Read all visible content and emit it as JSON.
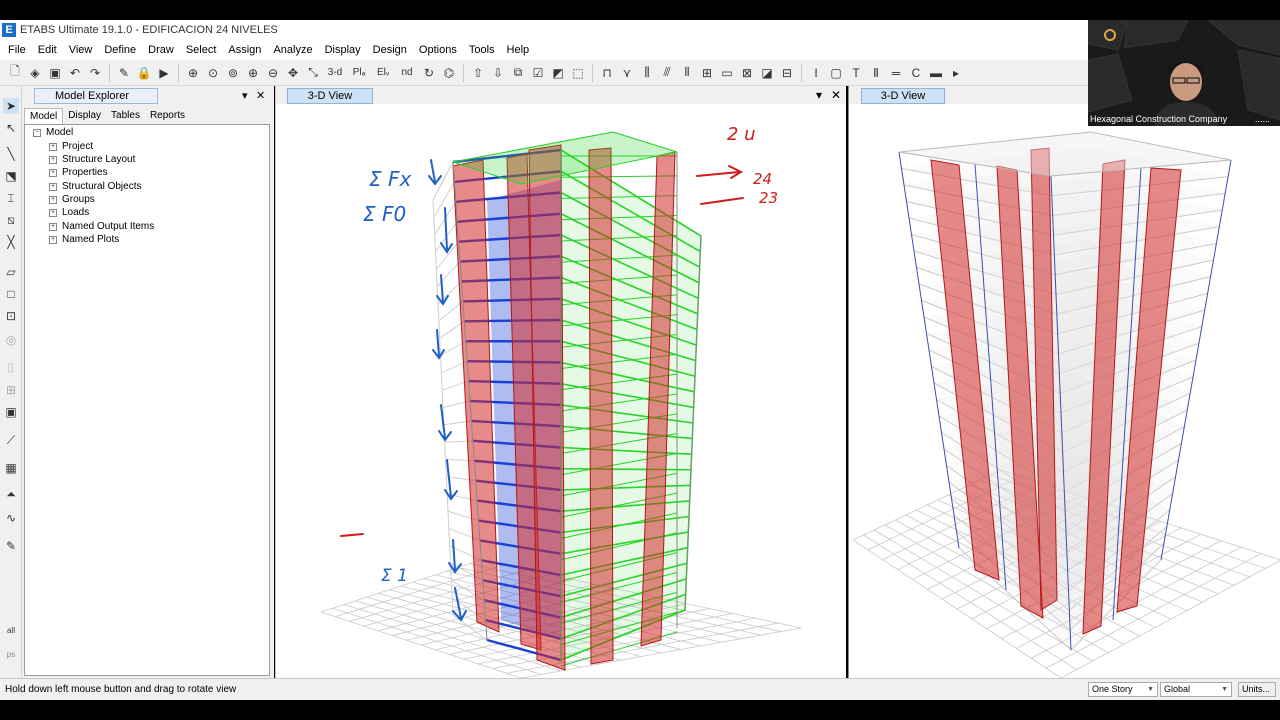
{
  "app": {
    "logo_letter": "E",
    "title": "ETABS Ultimate 19.1.0 - EDIFICACION 24 NIVELES"
  },
  "menu": [
    "File",
    "Edit",
    "View",
    "Define",
    "Draw",
    "Select",
    "Assign",
    "Analyze",
    "Display",
    "Design",
    "Options",
    "Tools",
    "Help"
  ],
  "toolbar": {
    "view_3d": "3-d",
    "view_plan": "Plₐ",
    "view_elev": "Elᵥ",
    "view_nd": "nd"
  },
  "explorer": {
    "title": "Model Explorer",
    "tabs": [
      "Model",
      "Display",
      "Tables",
      "Reports"
    ],
    "active_tab": "Model",
    "root": "Model",
    "items": [
      "Project",
      "Structure Layout",
      "Properties",
      "Structural Objects",
      "Groups",
      "Loads",
      "Named Output Items",
      "Named Plots"
    ]
  },
  "views": {
    "left_title": "3-D View",
    "right_title": "3-D View"
  },
  "annotations": {
    "a1": "Σ Fx",
    "a2": "Σ F0",
    "a3": "2 u",
    "a4": "24",
    "a5": "23",
    "a6": "Σ 1"
  },
  "lefttools": {
    "all": "all",
    "ps": "ps"
  },
  "status": {
    "message": "Hold down left mouse button and drag to rotate view",
    "story": "One Story",
    "coord": "Global",
    "units": "Units..."
  },
  "webcam": {
    "caption": "Hexagonal Construction Company",
    "dots": "......"
  },
  "colors": {
    "wall": "#d42a2a",
    "slab_green": "#27d427",
    "beam_blue": "#1a3fd4",
    "grid": "#c8c8c8",
    "annotation": "#1e5fc8"
  }
}
